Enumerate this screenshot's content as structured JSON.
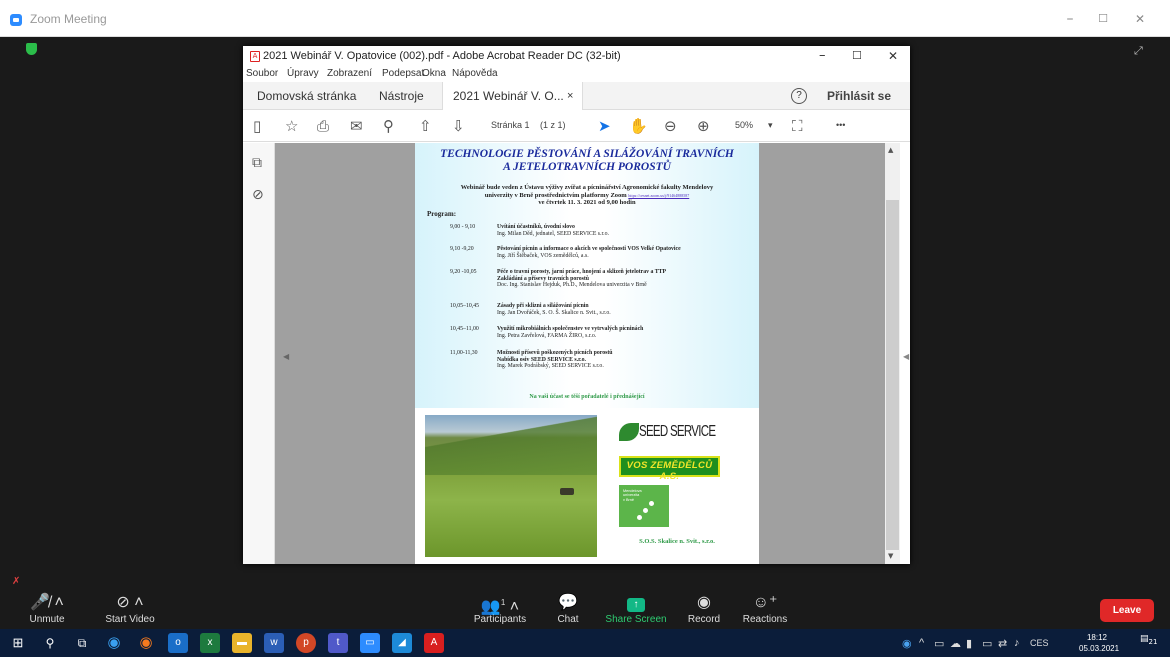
{
  "window": {
    "title": "Zoom Meeting",
    "minimize": "–",
    "maximize": "☐",
    "close": "✕"
  },
  "acrobat": {
    "title": "2021 Webinář V. Opatovice (002).pdf - Adobe Acrobat Reader DC (32-bit)",
    "controls": {
      "min": "–",
      "max": "☐",
      "close": "✕"
    },
    "menu": [
      "Soubor",
      "Úpravy",
      "Zobrazení",
      "Podepsat",
      "Okna",
      "Nápověda"
    ],
    "tabs": {
      "home": "Domovská stránka",
      "tools": "Nástroje",
      "doc": "2021 Webinář V. O...",
      "doc_close": "×"
    },
    "help": "?",
    "signin": "Přihlásit se",
    "toolbar": {
      "page": "Stránka 1",
      "pagecount": "(1 z 1)",
      "zoom": "50%",
      "more": "•••"
    }
  },
  "document": {
    "title_line1": "TECHNOLOGIE PĚSTOVÁNÍ A SILÁŽOVÁNÍ TRAVNÍCH",
    "title_line2": "A JETELOTRAVNÍCH POROSTŮ",
    "intro1": "Webinář bude veden z Ústavu výživy zvířat a pícninářství Agronomické fakulty Mendelovy",
    "intro2": "univerzity v Brně prostřednictvím platformy Zoom",
    "intro_link": "https://cesnet.zoom.us/j/91464888587",
    "intro3": "ve čtvrtek 11. 3. 2021 od 9,00 hodin",
    "program_label": "Program:",
    "program": [
      {
        "time": "9,00 - 9,10",
        "lines": [
          "Uvítání účastníků, úvodní slovo",
          "Ing. Milan Děd, jednatel, SEED SERVICE s.r.o."
        ]
      },
      {
        "time": "9,10 -9,20",
        "lines": [
          "Pěstování pícnin a informace o akcích ve společnosti VOS Velké Opatovice",
          "Ing. Jiří Štěbaček, VOS zemědělců, a.s."
        ]
      },
      {
        "time": "9,20 -10,05",
        "lines": [
          "Péče o travní porosty, jarní práce, hnojení a sklizeň jetelotrav a TTP",
          "Zakládání a přísevy travních porostů",
          "Doc. Ing. Stanislav Hejduk, Ph.D., Mendelova univerzita v Brně"
        ]
      },
      {
        "time": "10,05–10,45",
        "lines": [
          "Zásady při sklizni a silážování pícnin",
          "Ing. Jan Dvořáček, S. O. Š. Skalice n. Svit., s.r.o."
        ]
      },
      {
        "time": "10,45–11,00",
        "lines": [
          "Využití mikrobiálních společenstev ve vytrvalých pícninách",
          "Ing. Petra Zavřelová, FARMA ŽIRO, s.r.o."
        ]
      },
      {
        "time": "11,00-11,30",
        "lines": [
          "Možnosti přísevů poškozených pícních porostů",
          "Nabídka osiv SEED SERVICE s.r.o.",
          "Ing. Marek Podrábský, SEED SERVICE s.r.o."
        ]
      }
    ],
    "thanks": "Na vaši účast se těší pořadatelé i přednášející",
    "logo_seed": "SEED SERVICE",
    "logo_vos": "VOS ZEMĚDĚLCŮ A.S.",
    "logo_mendel": "Mendelova\nuniverzita\nv Brně",
    "logo_sos": "S.O.S. Skalice n. Svit., s.r.o."
  },
  "controls": {
    "unmute": "Unmute",
    "start_video": "Start Video",
    "participants": "Participants",
    "participants_count": "1",
    "chat": "Chat",
    "share": "Share Screen",
    "record": "Record",
    "reactions": "Reactions",
    "leave": "Leave"
  },
  "taskbar": {
    "lang": "CES",
    "time": "18:12",
    "date": "05.03.2021",
    "notifications": "21"
  }
}
